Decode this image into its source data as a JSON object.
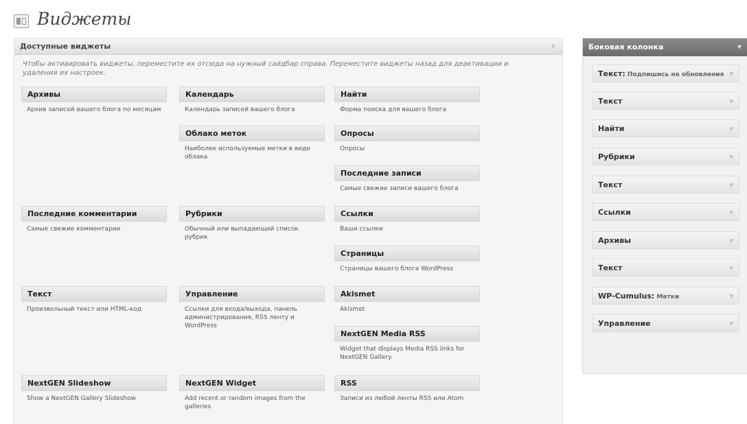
{
  "page": {
    "title": "Виджеты"
  },
  "available": {
    "title": "Доступные виджеты",
    "description": "Чтобы активировать виджеты, переместите их отсюда на нужный сайдбар справа. Переместите виджеты назад для деактивации и удаления их настроек.",
    "widgets": [
      {
        "title": "Архивы",
        "desc": "Архив записей вашего блога по месяцам"
      },
      {
        "title": "Календарь",
        "desc": "Календарь записей вашего блога"
      },
      {
        "title": "Найти",
        "desc": "Форма поиска для вашего блога"
      },
      {
        "title": "Облако меток",
        "desc": "Наиболее используемые метки в виде облака"
      },
      {
        "title": "Опросы",
        "desc": "Опросы"
      },
      {
        "title": "Последние записи",
        "desc": "Самые свежие записи вашего блога"
      },
      {
        "title": "Последние комментарии",
        "desc": "Самые свежие комментарии"
      },
      {
        "title": "Рубрики",
        "desc": "Обычный или выпадающий список рубрик"
      },
      {
        "title": "Ссылки",
        "desc": "Ваши ссылки"
      },
      {
        "title": "Страницы",
        "desc": "Страницы вашего блога WordPress"
      },
      {
        "title": "Текст",
        "desc": "Произвольный текст или HTML-код"
      },
      {
        "title": "Управление",
        "desc": "Ссылки для входа/выхода, панель администрирования, RSS ленту и WordPress"
      },
      {
        "title": "Akismet",
        "desc": "Akismet"
      },
      {
        "title": "NextGEN Media RSS",
        "desc": "Widget that displays Media RSS links for NextGEN Gallery."
      },
      {
        "title": "NextGEN Slideshow",
        "desc": "Show a NextGEN Gallery Slideshow"
      },
      {
        "title": "NextGEN Widget",
        "desc": "Add recent or random images from the galleries"
      },
      {
        "title": "RSS",
        "desc": "Записи из любой ленты RSS или Atom"
      }
    ]
  },
  "sidebar": {
    "title": "Боковая колонка",
    "items": [
      {
        "title": "Текст:",
        "subtitle": " Подпишись на обновления"
      },
      {
        "title": "Текст",
        "subtitle": ""
      },
      {
        "title": "Найти",
        "subtitle": ""
      },
      {
        "title": "Рубрики",
        "subtitle": ""
      },
      {
        "title": "Текст",
        "subtitle": ""
      },
      {
        "title": "Ссылки",
        "subtitle": ""
      },
      {
        "title": "Архивы",
        "subtitle": ""
      },
      {
        "title": "Текст",
        "subtitle": ""
      },
      {
        "title": "WP-Cumulus:",
        "subtitle": " Метки"
      },
      {
        "title": "Управление",
        "subtitle": ""
      }
    ]
  },
  "icons": {
    "page": "widgets-icon",
    "collapse": "triangle-down-icon"
  }
}
